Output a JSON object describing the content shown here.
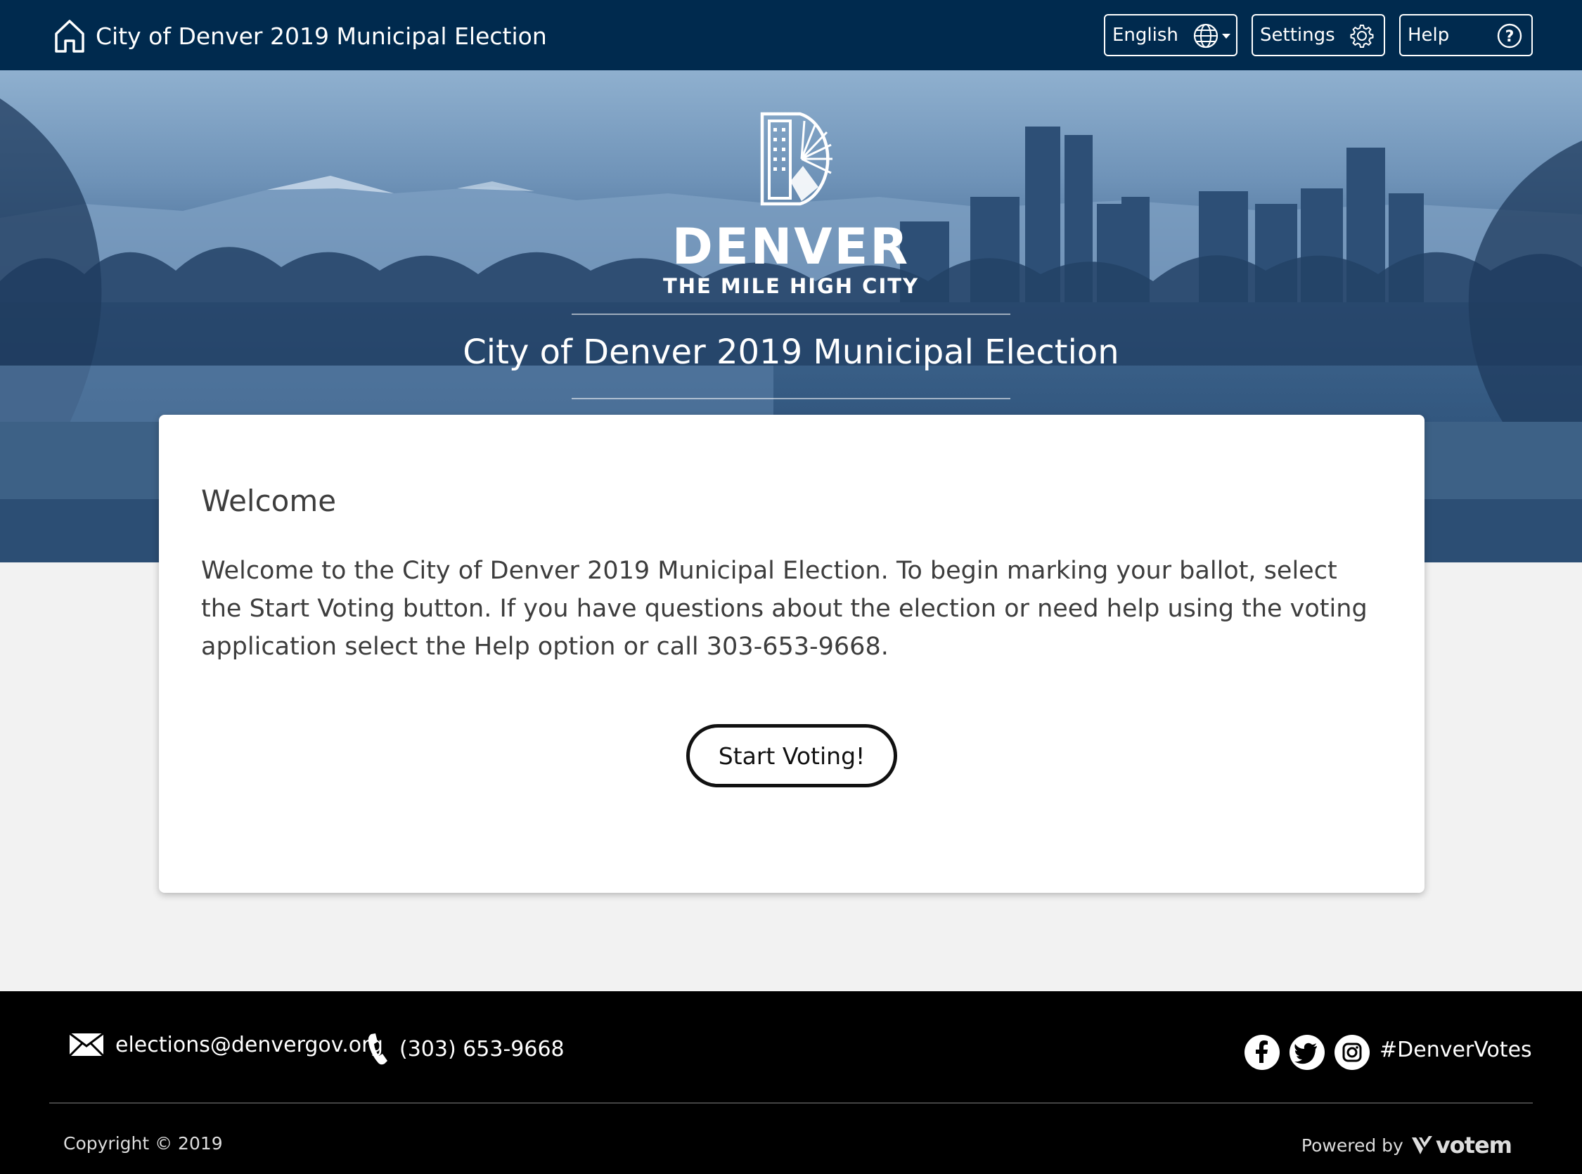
{
  "header": {
    "title": "City of Denver 2019 Municipal Election",
    "language_label": "English",
    "settings_label": "Settings",
    "help_label": "Help"
  },
  "hero": {
    "logo_wordmark": "DENVER",
    "logo_tagline": "THE MILE HIGH CITY",
    "title": "City of Denver 2019 Municipal Election"
  },
  "welcome": {
    "heading": "Welcome",
    "body": "Welcome to the City of Denver 2019 Municipal Election. To begin marking your ballot, select the Start Voting button. If you have questions about the election or need help using the voting application select the Help option or call 303-653-9668.",
    "start_button_label": "Start Voting!"
  },
  "footer": {
    "email": "elections@denvergov.org",
    "phone": "(303) 653-9668",
    "hashtag": "#DenverVotes",
    "copyright": "Copyright © 2019",
    "powered_by_label": "Powered by",
    "powered_by_brand": "votem"
  },
  "icons": {
    "home": "home-icon",
    "language": "globe-icon",
    "settings": "gear-icon",
    "help": "question-circle-icon",
    "email": "envelope-icon",
    "phone": "phone-icon",
    "social": [
      "facebook-icon",
      "twitter-icon",
      "instagram-icon"
    ]
  },
  "colors": {
    "nav_background": "#002a4e",
    "hero_tint": "#3a6088",
    "page_background": "#f2f2f2",
    "footer_background": "#000000",
    "text": "#3d3d3d"
  }
}
